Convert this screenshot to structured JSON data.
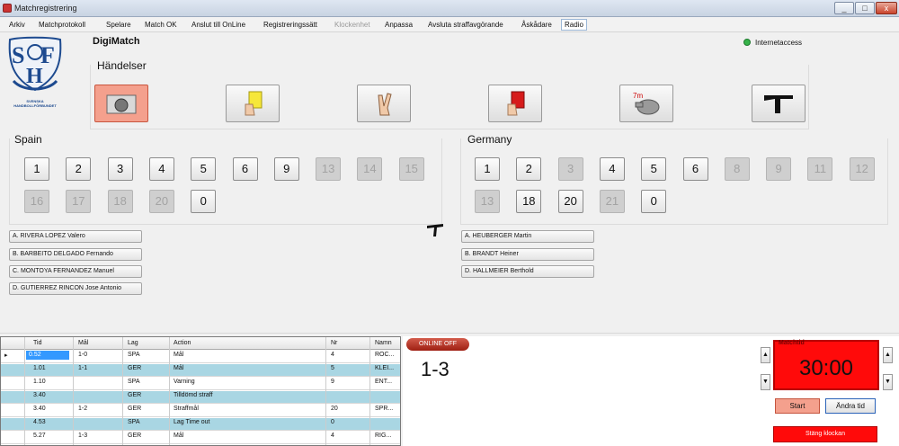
{
  "window": {
    "title": "Matchregistrering",
    "min": "_",
    "max": "□",
    "close": "x"
  },
  "menu": [
    {
      "label": "Arkiv",
      "disabled": false
    },
    {
      "label": "Matchprotokoll",
      "disabled": false
    },
    {
      "label": "Spelare",
      "disabled": false
    },
    {
      "label": "Match OK",
      "disabled": false
    },
    {
      "label": "Anslut till OnLine",
      "disabled": false
    },
    {
      "label": "Registreringssätt",
      "disabled": false
    },
    {
      "label": "Klockenhet",
      "disabled": true
    },
    {
      "label": "Anpassa",
      "disabled": false
    },
    {
      "label": "Avsluta straffavgörande",
      "disabled": false
    },
    {
      "label": "Åskådare",
      "disabled": false
    },
    {
      "label": "Radio",
      "disabled": false
    }
  ],
  "brand": "DigiMatch",
  "logo": {
    "letters": "SHF",
    "caption": "SVENSKA HANDBOLLFÖRBUNDET"
  },
  "status": {
    "internet": "Internetaccess",
    "internet_color": "#37b34a"
  },
  "events": {
    "title": "Händelser",
    "buttons": [
      {
        "icon": "goal-ball-icon",
        "active": true
      },
      {
        "icon": "yellow-card-icon",
        "active": false
      },
      {
        "icon": "two-minutes-icon",
        "active": false
      },
      {
        "icon": "red-card-icon",
        "active": false
      },
      {
        "icon": "whistle-7m-icon",
        "active": false,
        "badge": "7m"
      },
      {
        "icon": "timeout-t-icon",
        "active": false
      }
    ]
  },
  "teams": [
    {
      "name": "Spain",
      "players": [
        {
          "no": "1",
          "active": true
        },
        {
          "no": "2",
          "active": true
        },
        {
          "no": "3",
          "active": true
        },
        {
          "no": "4",
          "active": true,
          "marker": "gray"
        },
        {
          "no": "5",
          "active": true
        },
        {
          "no": "6",
          "active": true
        },
        {
          "no": "9",
          "active": true,
          "marker": "yellow"
        },
        {
          "no": "13",
          "active": false
        },
        {
          "no": "14",
          "active": false
        },
        {
          "no": "15",
          "active": false
        },
        {
          "no": "16",
          "active": false
        },
        {
          "no": "17",
          "active": false
        },
        {
          "no": "18",
          "active": false
        },
        {
          "no": "20",
          "active": false
        },
        {
          "no": "0",
          "active": true
        }
      ],
      "officials": [
        "A. RIVERA LOPEZ Valero",
        "B. BARBEITO DELGADO Fernando",
        "C. MONTOYA FERNANDEZ Manuel",
        "D. GUTIERREZ RINCON Jose Antonio"
      ]
    },
    {
      "name": "Germany",
      "players": [
        {
          "no": "1",
          "active": true
        },
        {
          "no": "2",
          "active": true
        },
        {
          "no": "3",
          "active": false
        },
        {
          "no": "4",
          "active": true,
          "marker": "gray"
        },
        {
          "no": "5",
          "active": true,
          "marker": "gray"
        },
        {
          "no": "6",
          "active": true
        },
        {
          "no": "8",
          "active": false
        },
        {
          "no": "9",
          "active": false
        },
        {
          "no": "11",
          "active": false
        },
        {
          "no": "12",
          "active": false
        },
        {
          "no": "13",
          "active": false
        },
        {
          "no": "18",
          "active": true
        },
        {
          "no": "20",
          "active": true,
          "marker": "red"
        },
        {
          "no": "21",
          "active": false
        },
        {
          "no": "0",
          "active": true
        }
      ],
      "officials": [
        "A. HEUBERGER Martin",
        "B. BRANDT Heiner",
        "D. HALLMEIER Berthold"
      ]
    }
  ],
  "table": {
    "columns": [
      "Tid",
      "Mål",
      "Lag",
      "Action",
      "Nr",
      "Namn"
    ],
    "rows": [
      {
        "tid": "0.52",
        "mal": "1-0",
        "lag": "SPA",
        "action": "Mål",
        "nr": "4",
        "namn": "ROC...",
        "selected": true,
        "highlight": false
      },
      {
        "tid": "1.01",
        "mal": "1-1",
        "lag": "GER",
        "action": "Mål",
        "nr": "5",
        "namn": "KLEI...",
        "selected": false,
        "highlight": true
      },
      {
        "tid": "1.10",
        "mal": "",
        "lag": "SPA",
        "action": "Varning",
        "nr": "9",
        "namn": "ENT...",
        "selected": false,
        "highlight": false
      },
      {
        "tid": "3.40",
        "mal": "",
        "lag": "GER",
        "action": "Tilldömd straff",
        "nr": "",
        "namn": "",
        "selected": false,
        "highlight": true
      },
      {
        "tid": "3.40",
        "mal": "1-2",
        "lag": "GER",
        "action": "Straffmål",
        "nr": "20",
        "namn": "SPR...",
        "selected": false,
        "highlight": false
      },
      {
        "tid": "4.53",
        "mal": "",
        "lag": "SPA",
        "action": "Lag Time out",
        "nr": "0",
        "namn": "",
        "selected": false,
        "highlight": true
      },
      {
        "tid": "5.27",
        "mal": "1-3",
        "lag": "GER",
        "action": "Mål",
        "nr": "4",
        "namn": "RIG...",
        "selected": false,
        "highlight": false
      }
    ]
  },
  "online_badge": "ONLINE OFF",
  "score": "1-3",
  "clock": {
    "label": "Matchtid",
    "time": "30:00",
    "start": "Start",
    "change": "Ändra tid",
    "spin_up": "▲",
    "spin_down": "▼",
    "bar": "Stäng klockan",
    "color": "#ff0a0a"
  }
}
